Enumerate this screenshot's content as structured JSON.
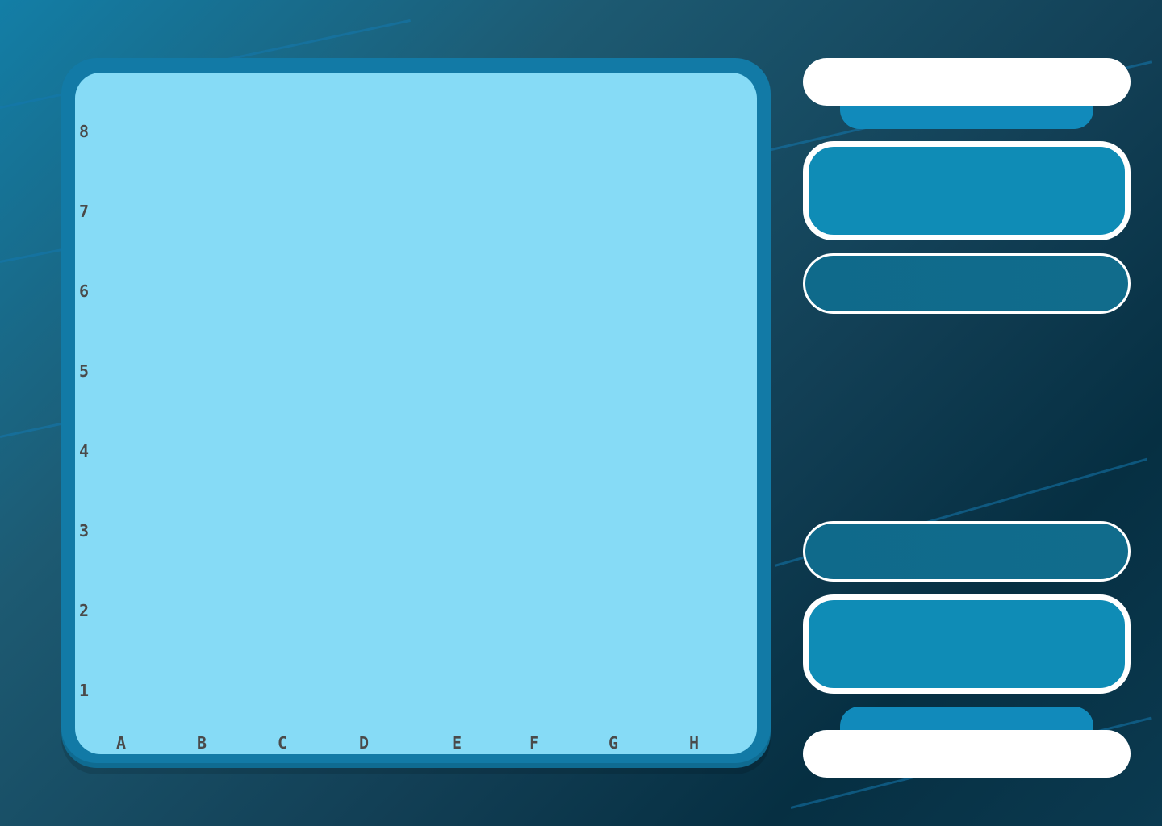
{
  "board": {
    "ranks": [
      "8",
      "7",
      "6",
      "5",
      "4",
      "3",
      "2",
      "1"
    ],
    "files": [
      "A",
      "B",
      "C",
      "D",
      "E",
      "F",
      "G",
      "H"
    ]
  },
  "panel": {
    "top_player_name": "",
    "bottom_player_name": ""
  },
  "colors": {
    "frame": "#127aa6",
    "board": "#86dbf6",
    "label": "#4a4a4a",
    "card": "#0f8cb6",
    "card_outline": "#ffffff"
  }
}
